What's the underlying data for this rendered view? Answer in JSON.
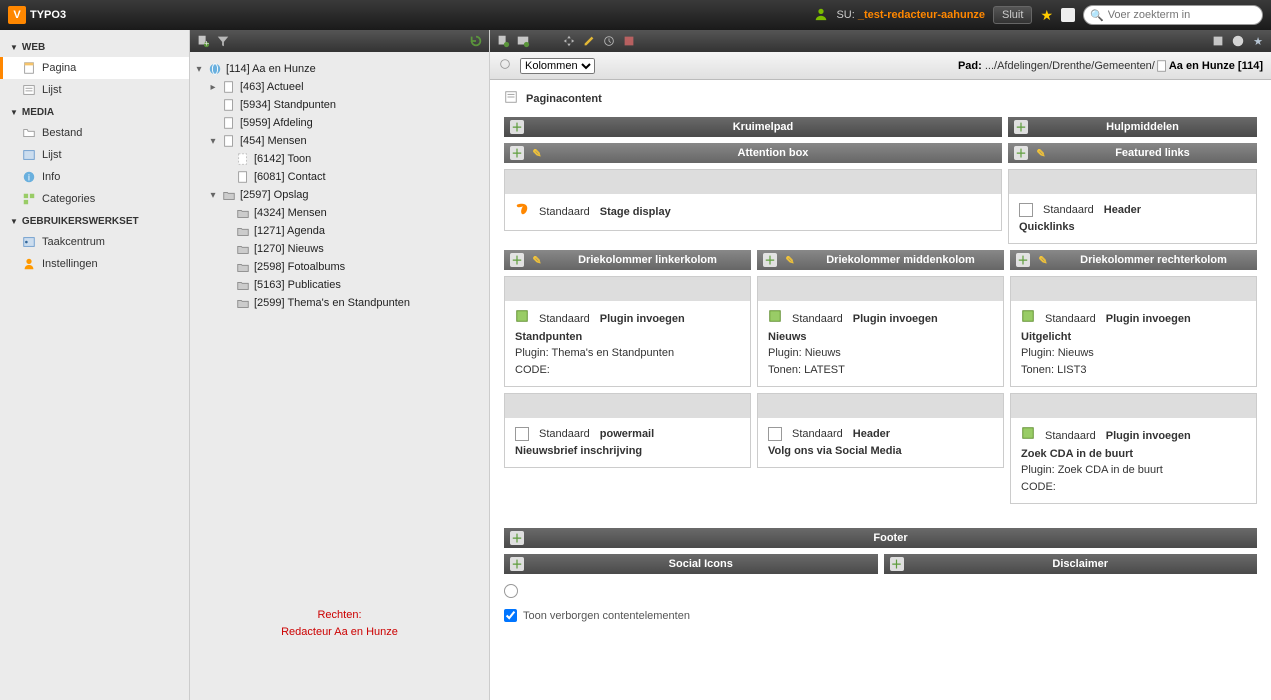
{
  "top": {
    "logo": "TYPO3",
    "su_prefix": "SU:",
    "su_user": "_test-redacteur-aahunze",
    "close": "Sluit",
    "search_placeholder": "Voer zoekterm in"
  },
  "modules": {
    "web": "WEB",
    "media": "MEDIA",
    "user": "GEBRUIKERSWERKSET",
    "web_items": [
      "Pagina",
      "Lijst"
    ],
    "media_items": [
      "Bestand",
      "Lijst",
      "Info",
      "Categories"
    ],
    "user_items": [
      "Taakcentrum",
      "Instellingen"
    ]
  },
  "tree": {
    "root": "[114] Aa en Hunze",
    "n1": "[463] Actueel",
    "n2": "[5934] Standpunten",
    "n3": "[5959] Afdeling",
    "n4": "[454] Mensen",
    "n4a": "[6142] Toon",
    "n4b": "[6081] Contact",
    "n5": "[2597] Opslag",
    "n5a": "[4324] Mensen",
    "n5b": "[1271] Agenda",
    "n5c": "[1270] Nieuws",
    "n5d": "[2598] Fotoalbums",
    "n5e": "[5163] Publicaties",
    "n5f": "[2599] Thema's en Standpunten",
    "note1": "Rechten:",
    "note2": "Redacteur Aa en Hunze"
  },
  "doc": {
    "layout_selector": "Kolommen",
    "path_label": "Pad:",
    "path_prefix": ".../Afdelingen/Drenthe/Gemeenten/",
    "path_page": "Aa en Hunze [114]",
    "content_header": "Paginacontent"
  },
  "cols": {
    "kruimelpad": "Kruimelpad",
    "hulpmiddelen": "Hulpmiddelen",
    "attention": "Attention box",
    "featured": "Featured links",
    "left": "Driekolommer linkerkolom",
    "mid": "Driekolommer middenkolom",
    "right": "Driekolommer rechterkolom",
    "footer": "Footer",
    "social": "Social Icons",
    "disclaimer": "Disclaimer"
  },
  "ce": {
    "std": "Standaard",
    "stage": "Stage display",
    "header": "Header",
    "quicklinks": "Quicklinks",
    "plugin": "Plugin invoegen",
    "powermail": "powermail",
    "left1_title": "Standpunten",
    "left1_l1": "Plugin: Thema's en Standpunten",
    "left1_l2": "CODE:",
    "left2_title": "Nieuwsbrief inschrijving",
    "mid1_title": "Nieuws",
    "mid1_l1": "Plugin: Nieuws",
    "mid1_l2": "Tonen: LATEST",
    "mid2_title": "Volg ons via Social Media",
    "right1_title": "Uitgelicht",
    "right1_l1": "Plugin: Nieuws",
    "right1_l2": "Tonen: LIST3",
    "right2_title": "Zoek CDA in de buurt",
    "right2_l1": "Plugin: Zoek CDA in de buurt",
    "right2_l2": "CODE:"
  },
  "footer": {
    "hidden_label": "Toon verborgen contentelementen"
  }
}
